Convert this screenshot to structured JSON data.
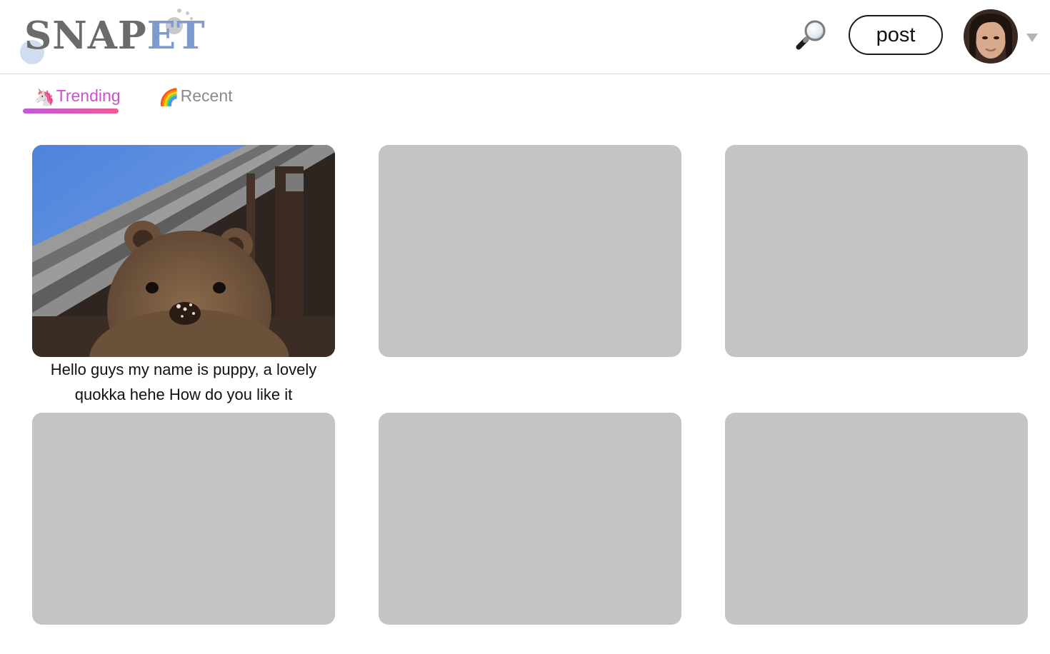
{
  "header": {
    "logo": {
      "text_part1": "SNAP",
      "text_part2": "ET"
    },
    "search_icon": "search-icon",
    "post_label": "post",
    "avatar_icon": "avatar",
    "menu_icon": "chevron-down-icon"
  },
  "tabs": [
    {
      "emoji": "🦄",
      "label": "Trending",
      "active": true
    },
    {
      "emoji": "🌈",
      "label": "Recent",
      "active": false
    }
  ],
  "posts": [
    {
      "image": "quokka-photo",
      "caption": "Hello guys my name is puppy, a lovely quokka hehe How do you like it"
    },
    {
      "image": "placeholder"
    },
    {
      "image": "placeholder"
    },
    {
      "image": "placeholder"
    },
    {
      "image": "placeholder"
    },
    {
      "image": "placeholder"
    }
  ],
  "colors": {
    "active_tab": "#c653c9",
    "inactive_tab": "#8a8a8a",
    "underline_start": "#c15bd9",
    "underline_end": "#ee5a98",
    "placeholder": "#c4c4c4",
    "logo_grey": "#6b6b6b",
    "logo_blue": "#7d9bcf"
  }
}
